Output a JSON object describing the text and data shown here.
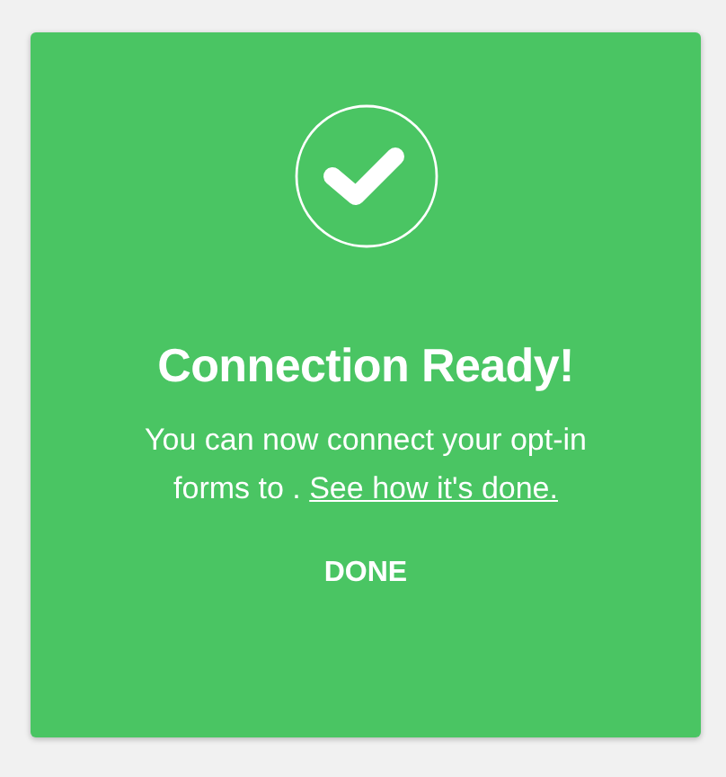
{
  "dialog": {
    "title": "Connection Ready!",
    "message": "You can now connect your opt-in forms to .",
    "link": "See how it's done.",
    "button": "DONE"
  }
}
